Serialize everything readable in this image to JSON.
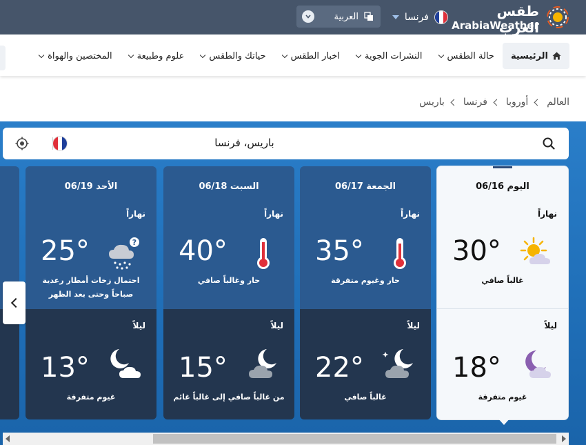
{
  "header": {
    "logo_ar": "طقس العرب",
    "logo_en": "ArabiaWeather",
    "country": "فرنسا",
    "language": "العربية"
  },
  "nav": {
    "items": [
      {
        "label": "الرئيسية",
        "icon": "home-icon"
      },
      {
        "label": "حالة الطقس"
      },
      {
        "label": "النشرات الجوية"
      },
      {
        "label": "اخبار الطقس"
      },
      {
        "label": "حياتك والطقس"
      },
      {
        "label": "علوم وطبيعة"
      },
      {
        "label": "المختصين والهواة"
      }
    ]
  },
  "breadcrumb": [
    "العالم",
    "أوروبا",
    "فرنسا",
    "باريس"
  ],
  "search": {
    "value": "باريس، فرنسا"
  },
  "forecast": {
    "day_label": "نهاراً",
    "night_label": "ليلاً",
    "cards": [
      {
        "date": "اليوم 06/16",
        "day_temp": "30°",
        "day_desc": "غالباً صافي",
        "day_icon": "sun-cloud-icon",
        "night_temp": "18°",
        "night_desc": "غيوم متفرقة",
        "night_icon": "moon-cloud-icon"
      },
      {
        "date": "الجمعة 06/17",
        "day_temp": "35°",
        "day_desc": "حار وغيوم متفرقة",
        "day_icon": "thermometer-icon",
        "night_temp": "22°",
        "night_desc": "غالباً صافي",
        "night_icon": "moon-cloud-star-icon"
      },
      {
        "date": "السبت 06/18",
        "day_temp": "40°",
        "day_desc": "حار وغالباً صافي",
        "day_icon": "thermometer-icon",
        "night_temp": "15°",
        "night_desc": "من غالباً صافي إلى غالباً غائم",
        "night_icon": "moon-cloud-icon"
      },
      {
        "date": "الأحد 06/19",
        "day_temp": "25°",
        "day_desc": "احتمال زخات أمطار رعدية صباحاً وحتى بعد الظهر",
        "day_icon": "storm-cloud-icon",
        "night_temp": "13°",
        "night_desc": "غيوم متفرقة",
        "night_icon": "moon-cloud-icon"
      }
    ]
  },
  "colors": {
    "topbar": "#46556a",
    "sky": "#2a7ec9",
    "day_card": "#2b5a90",
    "night_card": "#23364f",
    "flag_blue": "#1f3f9a",
    "flag_red": "#e0303a"
  }
}
